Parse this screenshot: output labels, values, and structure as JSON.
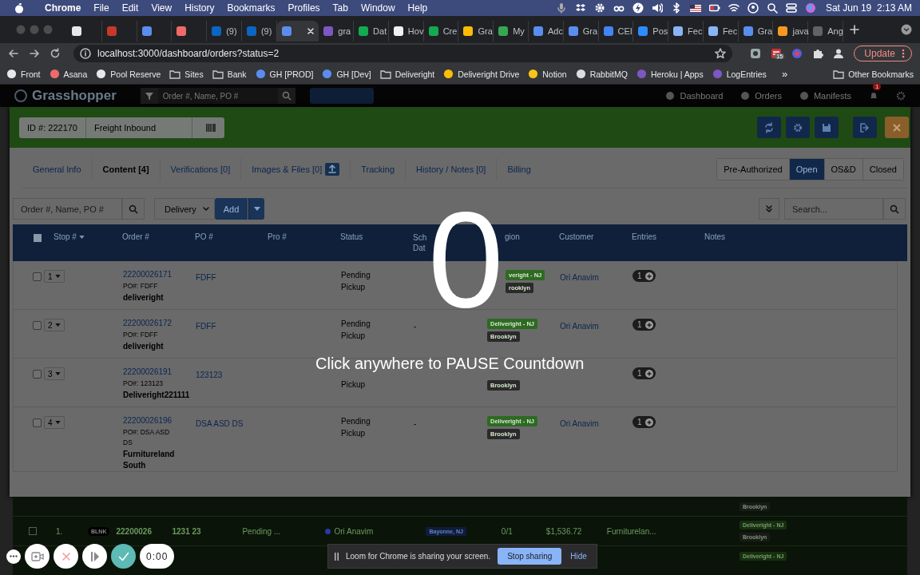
{
  "menubar": {
    "app": "Chrome",
    "menus": [
      "File",
      "Edit",
      "View",
      "History",
      "Bookmarks",
      "Profiles",
      "Tab",
      "Window",
      "Help"
    ],
    "clock": "Sat Jun 19  2:13 AM"
  },
  "browser_tabs": [
    {
      "color": "#e8e8e8",
      "selected": false
    },
    {
      "color": "#c5392b",
      "selected": false
    },
    {
      "color": "#5b8def",
      "selected": false
    },
    {
      "color": "#f06a6a",
      "selected": false
    },
    {
      "label": "(9)",
      "color": "#0a66c2",
      "selected": false
    },
    {
      "label": "(9)",
      "color": "#0a66c2",
      "selected": false
    },
    {
      "color": "#5b8def",
      "selected": true
    },
    {
      "label": "gra",
      "color": "#7e57c2",
      "selected": false
    },
    {
      "label": "Dat",
      "color": "#13aa52",
      "selected": false
    },
    {
      "label": "Hov",
      "color": "#f1f1f1",
      "selected": false
    },
    {
      "label": "Cre",
      "color": "#13aa52",
      "selected": false
    },
    {
      "label": "Gra",
      "color": "#fbbc04",
      "selected": false
    },
    {
      "label": "My",
      "color": "#34a853",
      "selected": false
    },
    {
      "label": "Adc",
      "color": "#5b8def",
      "selected": false
    },
    {
      "label": "Gra",
      "color": "#5b8def",
      "selected": false
    },
    {
      "label": "CEI",
      "color": "#4285f4",
      "selected": false
    },
    {
      "label": "Pos",
      "color": "#2d8cff",
      "selected": false
    },
    {
      "label": "Fec",
      "color": "#8ab4f8",
      "selected": false
    },
    {
      "label": "Fec",
      "color": "#8ab4f8",
      "selected": false
    },
    {
      "label": "Gra",
      "color": "#5b8def",
      "selected": false
    },
    {
      "label": "java",
      "color": "#f89820",
      "selected": false
    },
    {
      "label": "Ang",
      "color": "#5f6368",
      "selected": false
    }
  ],
  "address_bar": {
    "url": "localhost:3000/dashboard/orders?status=2",
    "extension_badge": "15",
    "update_button": "Update"
  },
  "bookmarks": [
    {
      "label": "Front",
      "kind": "site",
      "color": "#e8e8e8"
    },
    {
      "label": "Asana",
      "kind": "site",
      "color": "#f06a6a"
    },
    {
      "label": "Pool Reserve",
      "kind": "site",
      "color": "#e8e8e8"
    },
    {
      "label": "Sites",
      "kind": "folder"
    },
    {
      "label": "Bank",
      "kind": "folder"
    },
    {
      "label": "GH [PROD]",
      "kind": "site",
      "color": "#5b8def"
    },
    {
      "label": "GH [Dev]",
      "kind": "site",
      "color": "#5b8def"
    },
    {
      "label": "Deliveright",
      "kind": "folder"
    },
    {
      "label": "Deliveright Drive",
      "kind": "site",
      "color": "#fbbc04"
    },
    {
      "label": "Notion",
      "kind": "site",
      "color": "#f5c518"
    },
    {
      "label": "RabbitMQ",
      "kind": "site",
      "color": "#dddddd"
    },
    {
      "label": "Heroku | Apps",
      "kind": "site",
      "color": "#7e57c2"
    },
    {
      "label": "LogEntries",
      "kind": "site",
      "color": "#7e57c2"
    }
  ],
  "bookmarks_more": "»",
  "other_bookmarks": "Other Bookmarks",
  "app_nav": {
    "logo": "Grasshopper",
    "search_placeholder": "Order #, Name, PO #",
    "links": [
      "Dashboard",
      "Orders",
      "Manifests"
    ],
    "notification_count": "1"
  },
  "modal": {
    "id": "ID #: 222170",
    "type": "Freight Inbound",
    "tabs": [
      {
        "label": "General Info",
        "selected": false,
        "upload": false
      },
      {
        "label": "Content [4]",
        "selected": true,
        "upload": false
      },
      {
        "label": "Verifications [0]",
        "selected": false,
        "upload": false
      },
      {
        "label": "Images & Files [0]",
        "selected": false,
        "upload": true
      },
      {
        "label": "Tracking",
        "selected": false,
        "upload": false
      },
      {
        "label": "History / Notes [0]",
        "selected": false,
        "upload": false
      },
      {
        "label": "Billing",
        "selected": false,
        "upload": false
      }
    ],
    "statuses": [
      {
        "label": "Pre-Authorized",
        "selected": false
      },
      {
        "label": "Open",
        "selected": true
      },
      {
        "label": "OS&D",
        "selected": false
      },
      {
        "label": "Closed",
        "selected": false
      }
    ],
    "search_placeholder": "Order #, Name, PO #",
    "type_select": "Delivery",
    "add_button": "Add",
    "table_search_placeholder": "Search..."
  },
  "table": {
    "select_all_checked": false,
    "columns": [
      "Stop #",
      "Order #",
      "PO #",
      "Pro #",
      "Status",
      "Sch Dat",
      "gion",
      "Customer",
      "Entries",
      "Notes"
    ],
    "rows": [
      {
        "checked": false,
        "stop": "1",
        "order": "22200026171",
        "po_line": "PO#: FDFF",
        "name": "deliveright",
        "po": "FDFF",
        "status": [
          "Pending",
          "Pickup"
        ],
        "tags": [
          {
            "text": "veright - NJ",
            "color": "#2e6a22"
          },
          {
            "text": "rooklyn",
            "color": "#2a2a2a"
          }
        ],
        "customer": "Ori Anavim",
        "entries": "1"
      },
      {
        "checked": false,
        "stop": "2",
        "order": "22200026172",
        "po_line": "PO#: FDFF",
        "name": "deliveright",
        "po": "FDFF",
        "status": [
          "Pending",
          "Pickup"
        ],
        "sched": "-",
        "tags": [
          {
            "text": "Deliveright - NJ",
            "color": "#2e6a22"
          },
          {
            "text": "Brooklyn",
            "color": "#2a2a2a"
          }
        ],
        "customer": "Ori Anavim",
        "entries": "1"
      },
      {
        "checked": false,
        "stop": "3",
        "order": "22200026191",
        "po_line": "PO#: 123123",
        "name": "Deliveright221111",
        "po": "123123",
        "status": [
          "Pickup"
        ],
        "tags": [
          {
            "text": "Brooklyn",
            "color": "#2a2a2a"
          }
        ],
        "entries": "1"
      },
      {
        "checked": false,
        "stop": "4",
        "order": "22200026196",
        "po_line": "PO#: DSA ASD DS",
        "name": "Furnitureland South",
        "po": "DSA ASD DS",
        "status": [
          "Pending",
          "Pickup"
        ],
        "sched": "-",
        "tags": [
          {
            "text": "Deliveright - NJ",
            "color": "#2e6a22"
          },
          {
            "text": "Brooklyn",
            "color": "#2a2a2a"
          }
        ],
        "customer": "Ori Anavim",
        "entries": "1"
      }
    ]
  },
  "background_rows": [
    {
      "tags": [
        {
          "text": "Brooklyn",
          "color": "#1a1a1a"
        }
      ]
    },
    {
      "checked": false,
      "index": "1.",
      "badge": "BLNK",
      "order": "22200026",
      "po": "1231 23",
      "status": "Pending ...",
      "customer": "Ori Anavim",
      "location": "Bayonne, NJ",
      "count": "0/1",
      "amount": "$1,536.72",
      "consignee": "Furniturelan...",
      "tags": [
        {
          "text": "Deliveright - NJ",
          "color": "#16300f"
        },
        {
          "text": "Brooklyn",
          "color": "#1a1a1a"
        }
      ]
    },
    {
      "tags": [
        {
          "text": "Deliveright - NJ",
          "color": "#16300f"
        }
      ]
    }
  ],
  "countdown": {
    "number": "0",
    "hint": "Click anywhere to PAUSE Countdown"
  },
  "recorder": {
    "timer": "0:00"
  },
  "share_bar": {
    "message": "Loom for Chrome is sharing your screen.",
    "stop_button": "Stop sharing",
    "hide_button": "Hide"
  }
}
